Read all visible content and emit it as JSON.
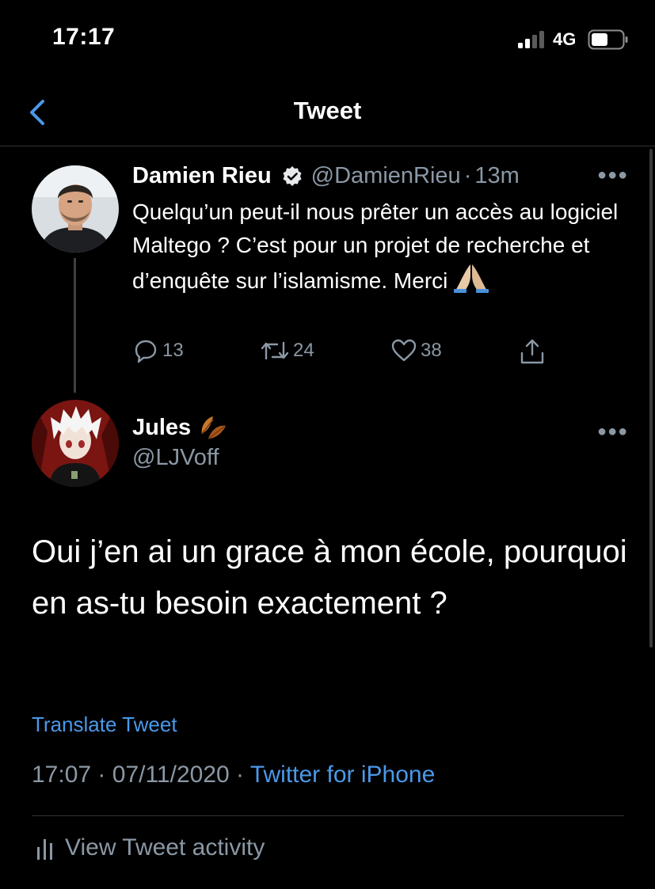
{
  "status_bar": {
    "time": "17:17",
    "network": "4G"
  },
  "nav": {
    "title": "Tweet"
  },
  "parent_tweet": {
    "author_name": "Damien Rieu",
    "handle": "@DamienRieu",
    "separator": "·",
    "age": "13m",
    "text": "Quelqu’un peut-il nous prêter un accès au logiciel Maltego ? C’est pour un projet de recherche et d’enquête sur l’islamisme. Merci",
    "reply_count": "13",
    "retweet_count": "24",
    "like_count": "38"
  },
  "main_tweet": {
    "author_name": "Jules",
    "handle": "@LJVoff",
    "text": "Oui j’en ai un grace à mon école, pourquoi en as-tu besoin exactement ?",
    "translate_label": "Translate Tweet",
    "time": "17:07",
    "date": "07/11/2020",
    "separator": "·",
    "source": "Twitter for iPhone",
    "activity_label": "View Tweet activity"
  },
  "colors": {
    "background": "#000000",
    "accent": "#4a99e9",
    "secondary_text": "#8b98a5",
    "divider": "#2f3336"
  }
}
